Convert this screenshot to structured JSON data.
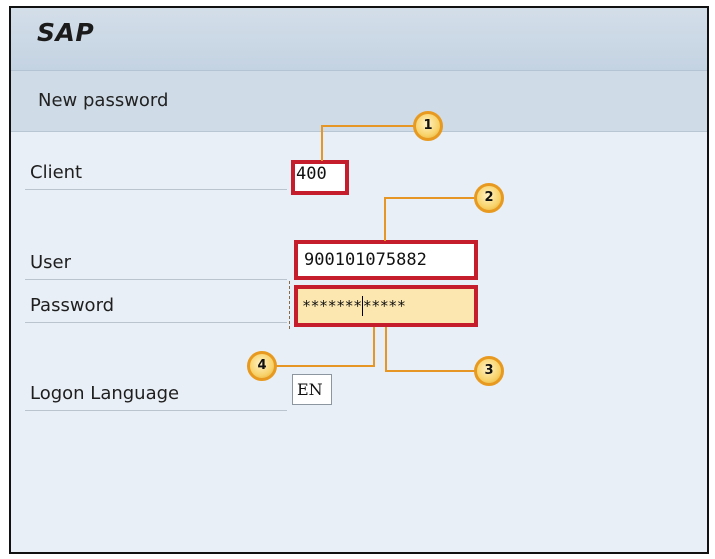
{
  "app": {
    "title": "SAP"
  },
  "screen": {
    "title": "New password"
  },
  "form": {
    "client": {
      "label": "Client",
      "value": "400"
    },
    "user": {
      "label": "User",
      "value": "900101075882"
    },
    "password": {
      "label": "Password",
      "mask_left": "*******",
      "mask_right": "*****"
    },
    "language": {
      "label": "Logon Language",
      "value": "EN"
    }
  },
  "callouts": [
    "1",
    "2",
    "3",
    "4"
  ],
  "colors": {
    "highlight_border": "#c51d2c",
    "callout": "#f8d36b",
    "connector": "#e69624",
    "password_bg": "#fde7b0"
  },
  "icons": {
    "text_cursor": "caret-icon"
  }
}
